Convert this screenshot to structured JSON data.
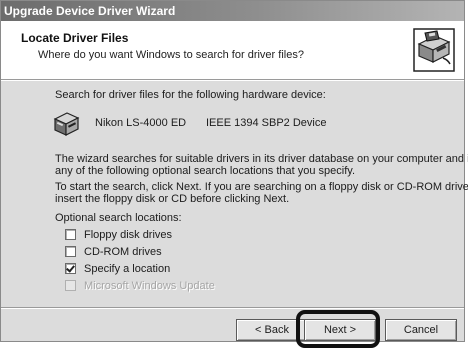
{
  "window": {
    "title": "Upgrade Device Driver Wizard"
  },
  "header": {
    "title": "Locate Driver Files",
    "subtitle": "Where do you want Windows to search for driver files?",
    "icon": "wizard-computer-disk-icon"
  },
  "body": {
    "prompt": "Search for driver files for the following hardware device:",
    "device": {
      "model": "Nikon   LS-4000 ED",
      "bus": "IEEE 1394 SBP2 Device",
      "icon": "scanner-icon"
    },
    "para1_line1": "The wizard searches for suitable drivers in its driver database on your computer and in",
    "para1_line2": "any of the following optional search locations that you specify.",
    "para2_line1": "To start the search, click Next. If you are searching on a floppy disk or CD-ROM drive,",
    "para2_line2": "insert the floppy disk or CD before clicking Next.",
    "options_label": "Optional search locations:",
    "options": [
      {
        "label": "Floppy disk drives",
        "checked": false,
        "enabled": true
      },
      {
        "label": "CD-ROM drives",
        "checked": false,
        "enabled": true
      },
      {
        "label": "Specify a location",
        "checked": true,
        "enabled": true
      },
      {
        "label": "Microsoft Windows Update",
        "checked": false,
        "enabled": false
      }
    ]
  },
  "buttons": {
    "back": "< Back",
    "next": "Next >",
    "cancel": "Cancel"
  },
  "annotation": {
    "highlighted": "next-button",
    "color": "#111111"
  }
}
